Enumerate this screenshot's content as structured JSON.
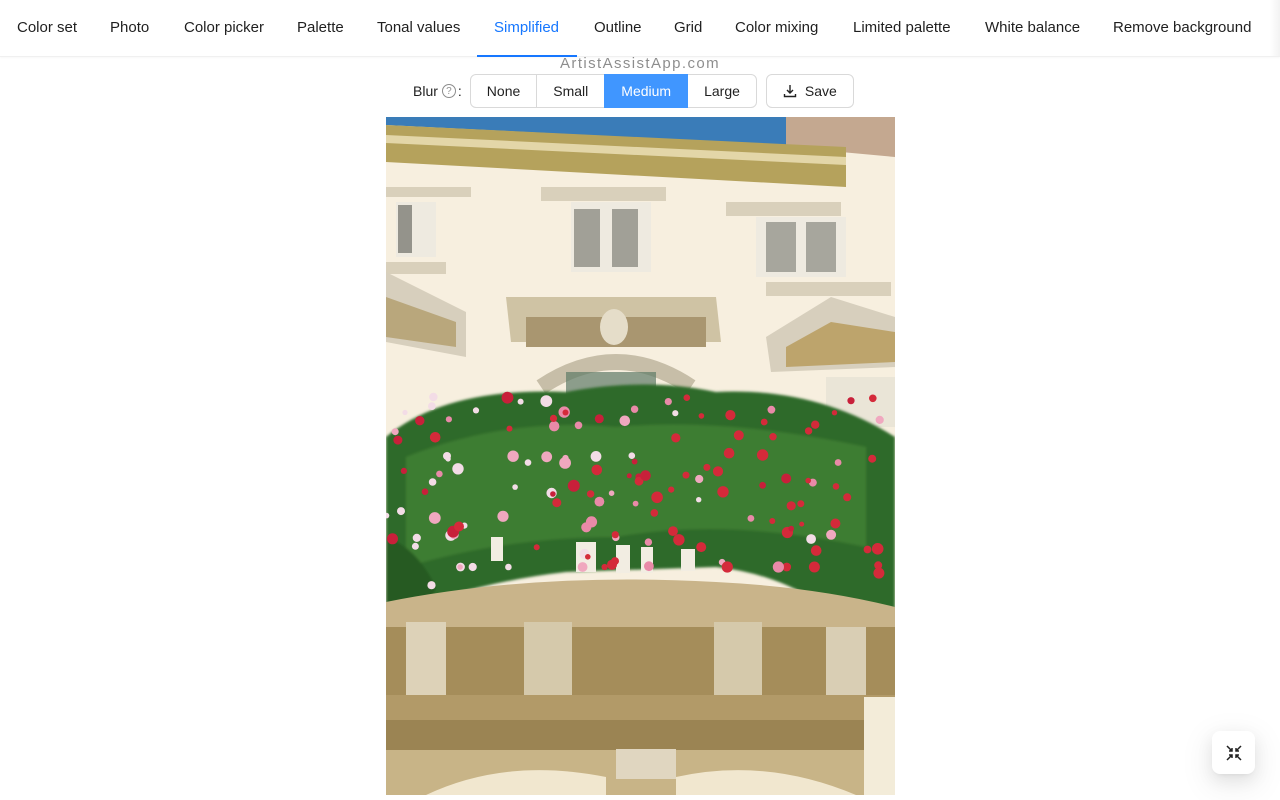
{
  "tabs": [
    {
      "label": "Color set",
      "active": false
    },
    {
      "label": "Photo",
      "active": false
    },
    {
      "label": "Color picker",
      "active": false
    },
    {
      "label": "Palette",
      "active": false
    },
    {
      "label": "Tonal values",
      "active": false
    },
    {
      "label": "Simplified",
      "active": true
    },
    {
      "label": "Outline",
      "active": false
    },
    {
      "label": "Grid",
      "active": false
    },
    {
      "label": "Color mixing",
      "active": false
    },
    {
      "label": "Limited palette",
      "active": false
    },
    {
      "label": "White balance",
      "active": false
    },
    {
      "label": "Remove background",
      "active": false
    }
  ],
  "watermark": "ArtistAssistApp.com",
  "controls": {
    "blur_label": "Blur",
    "blur_suffix": ":",
    "help_icon": "question-circle-icon",
    "blur_options": [
      "None",
      "Small",
      "Medium",
      "Large"
    ],
    "blur_selected": "Medium",
    "save_label": "Save",
    "save_icon": "download-icon"
  },
  "image": {
    "description": "Simplified (blurred) photo of a building facade with a balcony covered in red, pink and white geraniums",
    "alt": "Simplified photo"
  },
  "float_button": {
    "icon": "fullscreen-exit-icon"
  },
  "colors": {
    "accent": "#1677ff",
    "selected_segment": "#4096ff",
    "sky": "#3a7cb8",
    "facade": "#f7efdf",
    "foliage": "#2f6b2a",
    "flower_red": "#d42a3a",
    "flower_pink": "#e98aa8",
    "stone_dark": "#8a7040"
  }
}
